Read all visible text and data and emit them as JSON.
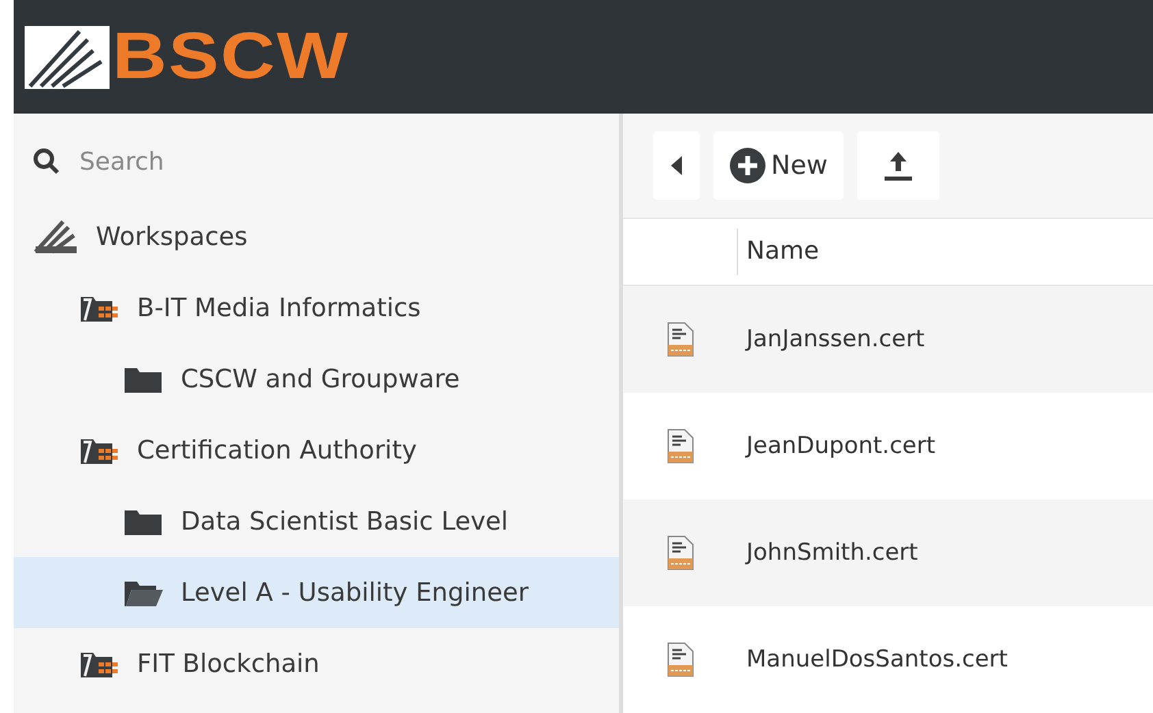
{
  "header": {
    "logo_text": "BSCW"
  },
  "sidebar": {
    "search": {
      "placeholder": "Search"
    },
    "root": {
      "label": "Workspaces",
      "children": [
        {
          "label": "B-IT Media Informatics",
          "kind": "workspace",
          "selected": false,
          "children": [
            {
              "label": "CSCW and Groupware",
              "kind": "folder",
              "selected": false
            }
          ]
        },
        {
          "label": "Certification Authority",
          "kind": "workspace",
          "selected": false,
          "children": [
            {
              "label": "Data Scientist Basic Level",
              "kind": "folder",
              "selected": false
            },
            {
              "label": "Level A - Usability Engineer",
              "kind": "folder",
              "selected": true
            }
          ]
        },
        {
          "label": "FIT Blockchain",
          "kind": "workspace",
          "selected": false
        }
      ]
    }
  },
  "toolbar": {
    "new_label": "New"
  },
  "table": {
    "columns": [
      "Name"
    ],
    "rows": [
      {
        "name": "JanJanssen.cert"
      },
      {
        "name": "JeanDupont.cert"
      },
      {
        "name": "JohnSmith.cert"
      },
      {
        "name": "ManuelDosSantos.cert"
      }
    ]
  }
}
